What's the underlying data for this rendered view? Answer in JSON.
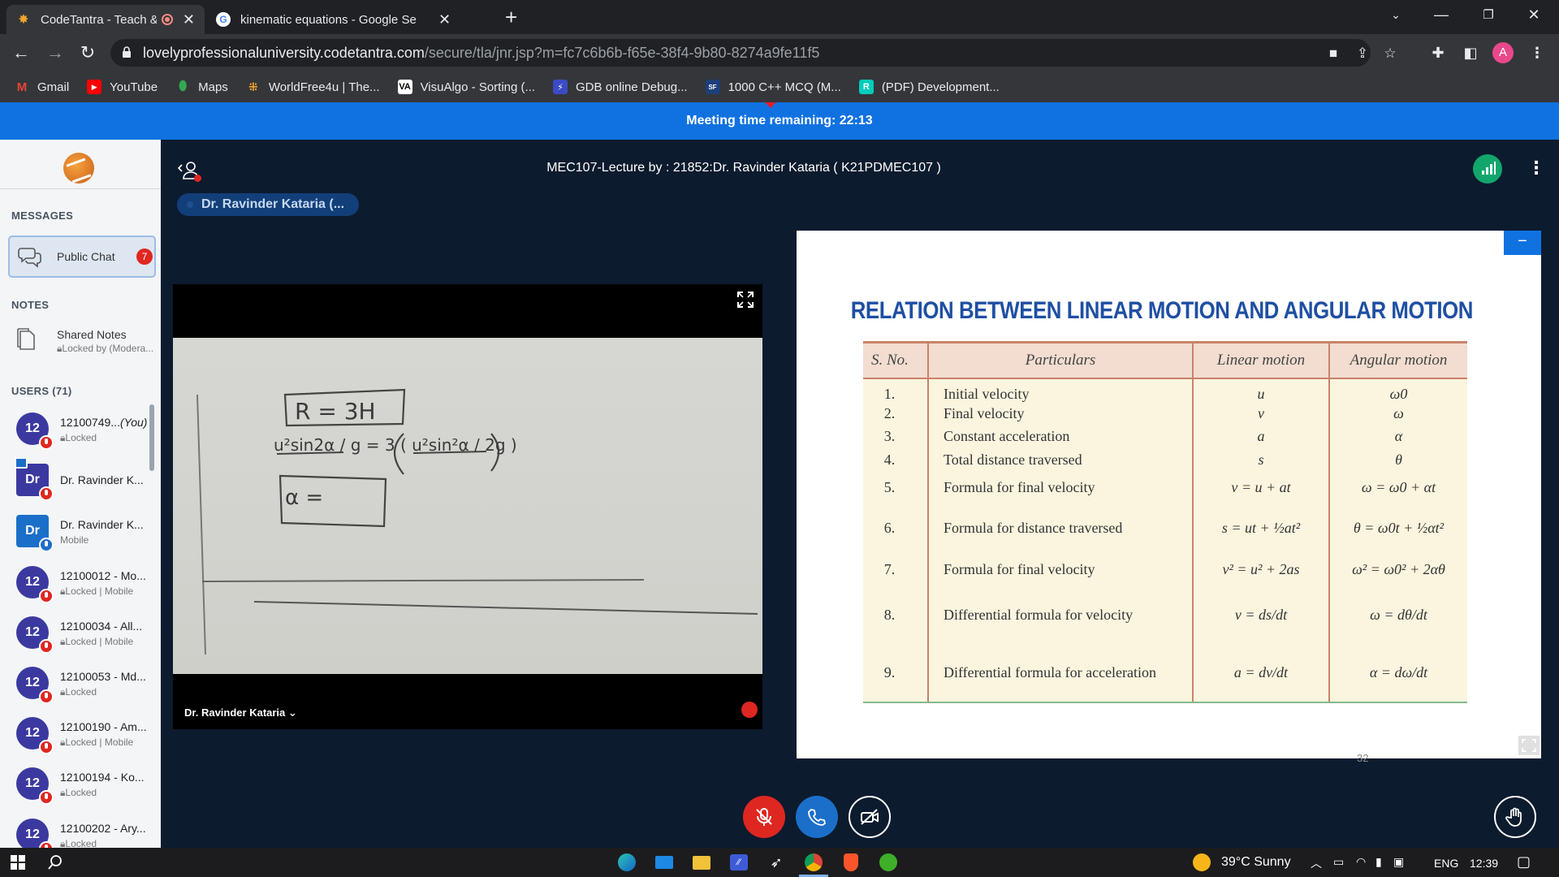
{
  "browser": {
    "tabs": [
      {
        "title": "CodeTantra - Teach & Learn /",
        "active": true
      },
      {
        "title": "kinematic equations - Google Se",
        "active": false
      }
    ],
    "url_host": "lovelyprofessionaluniversity.codetantra.com",
    "url_path": "/secure/tla/jnr.jsp?m=fc7c6b6b-f65e-38f4-9b80-8274a9fe11f5",
    "profile_initial": "A",
    "bookmarks": [
      "Gmail",
      "YouTube",
      "Maps",
      "WorldFree4u | The...",
      "VisuAlgo - Sorting (...",
      "GDB online Debug...",
      "1000 C++ MCQ (M...",
      "(PDF) Development..."
    ]
  },
  "meeting": {
    "banner": "Meeting time remaining: 22:13",
    "title": "MEC107-Lecture by : 21852:Dr. Ravinder Kataria ( K21PDMEC107 )",
    "talker": "Dr. Ravinder Kataria (...",
    "video_name": "Dr. Ravinder Kataria"
  },
  "sidebar": {
    "messages_header": "MESSAGES",
    "public_chat": "Public Chat",
    "chat_badge": "7",
    "notes_header": "NOTES",
    "shared_notes": "Shared Notes",
    "shared_notes_status": "Locked by (Modera...",
    "users_header": "USERS (71)",
    "users": [
      {
        "avatar": "12",
        "name": "12100749...",
        "you": "(You)",
        "status": "Locked"
      },
      {
        "avatar": "Dr",
        "name": "Dr. Ravinder K...",
        "status": ""
      },
      {
        "avatar": "Dr",
        "name": "Dr. Ravinder K...",
        "status": "Mobile"
      },
      {
        "avatar": "12",
        "name": "12100012 - Mo...",
        "status": "Locked | Mobile"
      },
      {
        "avatar": "12",
        "name": "12100034 - All...",
        "status": "Locked | Mobile"
      },
      {
        "avatar": "12",
        "name": "12100053 - Md...",
        "status": "Locked"
      },
      {
        "avatar": "12",
        "name": "12100190 - Am...",
        "status": "Locked | Mobile"
      },
      {
        "avatar": "12",
        "name": "12100194 - Ko...",
        "status": "Locked"
      },
      {
        "avatar": "12",
        "name": "12100202 - Ary...",
        "status": "Locked"
      }
    ]
  },
  "slide": {
    "title": "RELATION BETWEEN LINEAR MOTION AND ANGULAR MOTION",
    "headers": [
      "S. No.",
      "Particulars",
      "Linear motion",
      "Angular motion"
    ],
    "rows": [
      {
        "no": "1.",
        "particular": "Initial velocity",
        "linear": "u",
        "angular": "ω0"
      },
      {
        "no": "2.",
        "particular": "Final velocity",
        "linear": "v",
        "angular": "ω"
      },
      {
        "no": "3.",
        "particular": "Constant acceleration",
        "linear": "a",
        "angular": "α"
      },
      {
        "no": "4.",
        "particular": "Total distance traversed",
        "linear": "s",
        "angular": "θ"
      },
      {
        "no": "5.",
        "particular": "Formula for final velocity",
        "linear": "v = u + at",
        "angular": "ω = ω0 + αt"
      },
      {
        "no": "6.",
        "particular": "Formula for distance traversed",
        "linear": "s = ut + ½at²",
        "angular": "θ = ω0t + ½αt²"
      },
      {
        "no": "7.",
        "particular": "Formula for final velocity",
        "linear": "v² = u² + 2as",
        "angular": "ω² = ω0² + 2αθ"
      },
      {
        "no": "8.",
        "particular": "Differential formula for velocity",
        "linear": "v = ds/dt",
        "angular": "ω = dθ/dt"
      },
      {
        "no": "9.",
        "particular": "Differential formula for acceleration",
        "linear": "a = dv/dt",
        "angular": "α = dω/dt"
      }
    ],
    "page_number": "32"
  },
  "whiteboard": {
    "line1": "R = 3H",
    "line2": "u²sin2α / g = 3 ( u²sin²α / 2g )",
    "line3": "α ="
  },
  "taskbar": {
    "weather": "39°C  Sunny",
    "lang": "ENG",
    "time": "12:39"
  },
  "colors": {
    "banner": "#1072e0",
    "sidebar_bg": "#f3f5f7",
    "main_bg": "#0c1b2e",
    "slide_title": "#1f4fa3",
    "mute_red": "#df2721",
    "call_blue": "#1b6fc9",
    "connection_green": "#12a66d"
  }
}
